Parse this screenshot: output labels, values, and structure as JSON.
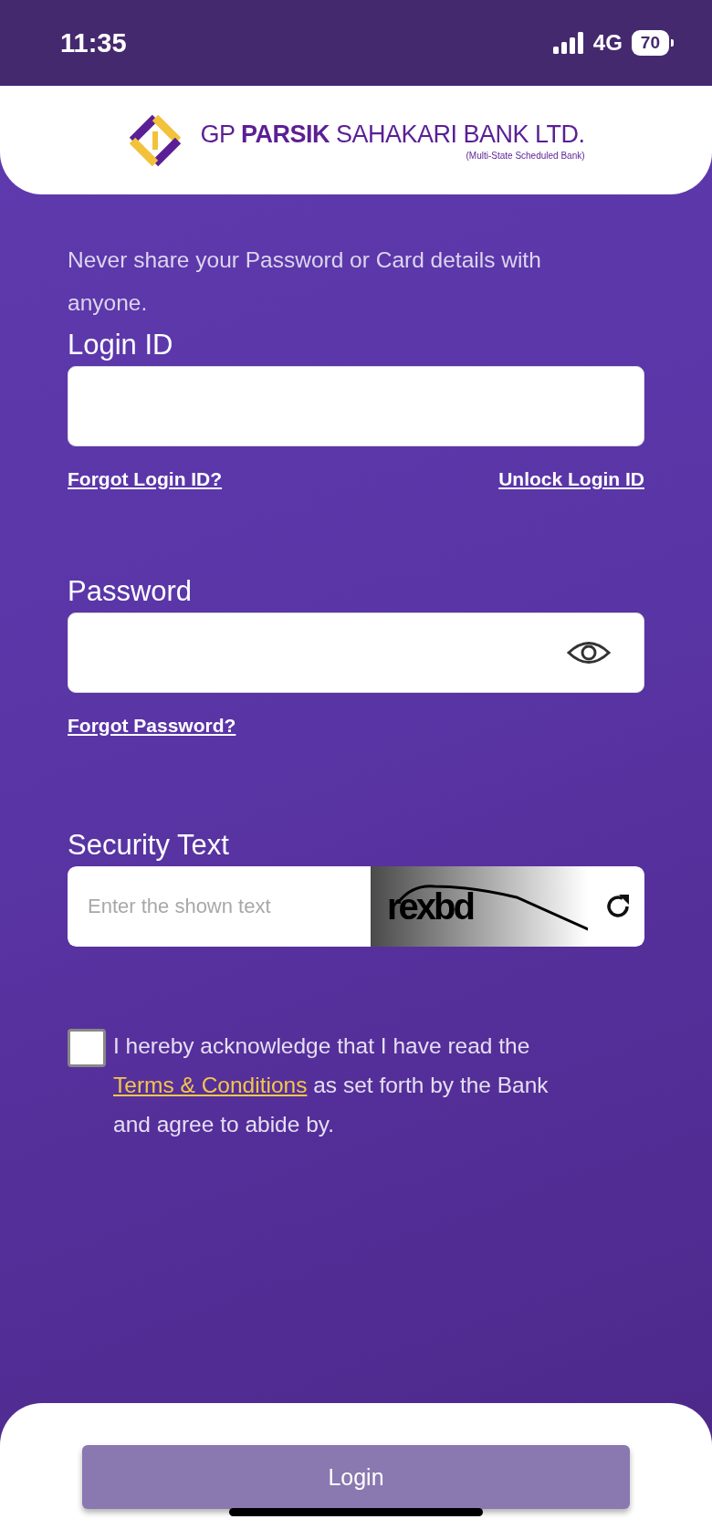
{
  "status_bar": {
    "time": "11:35",
    "network": "4G",
    "battery": "70"
  },
  "header": {
    "bank_name": "GP **PARSIK** SAHAKARI BANK LTD.",
    "tagline": "(Multi-State Scheduled Bank)"
  },
  "notice": "Never share your Password or Card details with anyone.",
  "fields": [
    {
      "kind": "text",
      "label": "Login ID",
      "links": [
        "Forgot Login ID?",
        "Unlock Login ID"
      ]
    },
    {
      "kind": "password",
      "label": "Password",
      "links": [
        "Forgot Password?"
      ]
    },
    {
      "kind": "captcha",
      "label": "Security Text",
      "placeholder": "Enter the shown text",
      "captcha_text": "rexbd"
    }
  ],
  "consent": {
    "checked": false,
    "before": "I hereby acknowledge that I have read the",
    "link": " Terms & Conditions",
    "after": " as set forth by the Bank and agree to abide by."
  },
  "login_button": {
    "label": "Login"
  }
}
